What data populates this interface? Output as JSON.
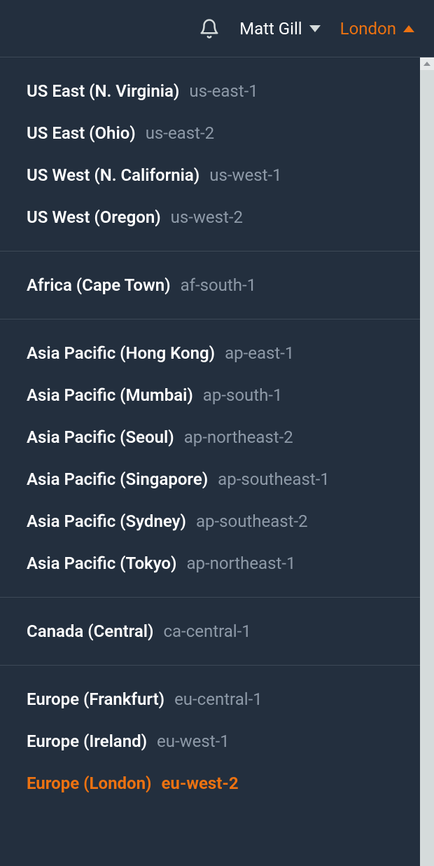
{
  "topbar": {
    "user_label": "Matt Gill",
    "region_label": "London"
  },
  "region_groups": [
    {
      "items": [
        {
          "name": "US East (N. Virginia)",
          "code": "us-east-1",
          "selected": false
        },
        {
          "name": "US East (Ohio)",
          "code": "us-east-2",
          "selected": false
        },
        {
          "name": "US West (N. California)",
          "code": "us-west-1",
          "selected": false
        },
        {
          "name": "US West (Oregon)",
          "code": "us-west-2",
          "selected": false
        }
      ]
    },
    {
      "items": [
        {
          "name": "Africa (Cape Town)",
          "code": "af-south-1",
          "selected": false
        }
      ]
    },
    {
      "items": [
        {
          "name": "Asia Pacific (Hong Kong)",
          "code": "ap-east-1",
          "selected": false
        },
        {
          "name": "Asia Pacific (Mumbai)",
          "code": "ap-south-1",
          "selected": false
        },
        {
          "name": "Asia Pacific (Seoul)",
          "code": "ap-northeast-2",
          "selected": false
        },
        {
          "name": "Asia Pacific (Singapore)",
          "code": "ap-southeast-1",
          "selected": false
        },
        {
          "name": "Asia Pacific (Sydney)",
          "code": "ap-southeast-2",
          "selected": false
        },
        {
          "name": "Asia Pacific (Tokyo)",
          "code": "ap-northeast-1",
          "selected": false
        }
      ]
    },
    {
      "items": [
        {
          "name": "Canada (Central)",
          "code": "ca-central-1",
          "selected": false
        }
      ]
    },
    {
      "items": [
        {
          "name": "Europe (Frankfurt)",
          "code": "eu-central-1",
          "selected": false
        },
        {
          "name": "Europe (Ireland)",
          "code": "eu-west-1",
          "selected": false
        },
        {
          "name": "Europe (London)",
          "code": "eu-west-2",
          "selected": true
        }
      ]
    }
  ]
}
